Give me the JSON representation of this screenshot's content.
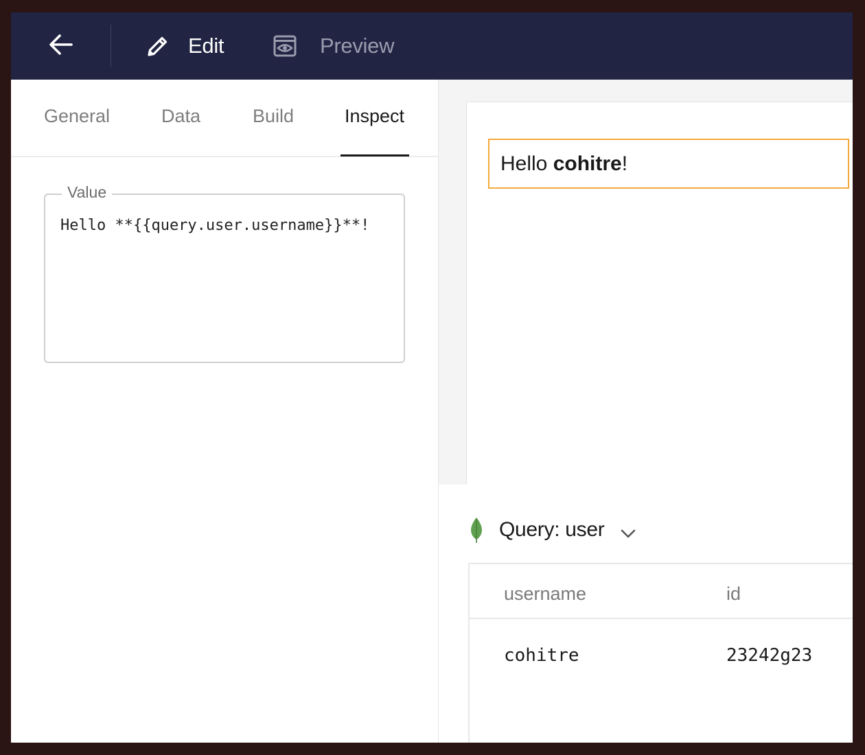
{
  "topbar": {
    "edit_label": "Edit",
    "preview_label": "Preview"
  },
  "tabs": [
    {
      "label": "General"
    },
    {
      "label": "Data"
    },
    {
      "label": "Build"
    },
    {
      "label": "Inspect"
    }
  ],
  "active_tab": "Inspect",
  "value_field": {
    "legend": "Value",
    "text": "Hello **{{query.user.username}}**!"
  },
  "preview": {
    "greeting_prefix": "Hello ",
    "greeting_name": "cohitre",
    "greeting_suffix": "!"
  },
  "query": {
    "title": "Query: user",
    "columns": [
      "username",
      "id"
    ],
    "rows": [
      [
        "cohitre",
        "23242g23"
      ]
    ]
  },
  "colors": {
    "topbar_bg": "#212443",
    "selection_outline": "#f3a93a",
    "mongo_leaf": "#5fa04e"
  }
}
